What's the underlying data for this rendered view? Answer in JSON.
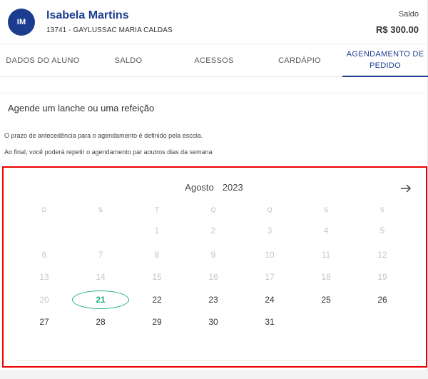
{
  "student": {
    "initials": "IM",
    "name": "Isabela Martins",
    "code_school": "13741 - GAYLUSSAC MARIA CALDAS",
    "balance_label": "Saldo",
    "balance_value": "R$ 300.00"
  },
  "tabs": [
    {
      "label": "DADOS DO ALUNO",
      "active": false
    },
    {
      "label": "SALDO",
      "active": false
    },
    {
      "label": "ACESSOS",
      "active": false
    },
    {
      "label": "CARDÁPIO",
      "active": false
    },
    {
      "label": "AGENDAMENTO DE PEDIDO",
      "active": true
    }
  ],
  "section_title": "Agende um lanche ou uma refeição",
  "info_lines": [
    "O prazo de antecedência para o agendamento é definido pela escola.",
    "Ao final, você poderá repetir o agendamento par aoutros dias da semana"
  ],
  "calendar": {
    "month": "Agosto",
    "year": "2023",
    "next_icon": "arrow-right-icon",
    "weekdays": [
      "D",
      "S",
      "T",
      "Q",
      "Q",
      "S",
      "S"
    ],
    "first_day_column": 2,
    "days_in_month": 31,
    "disabled_through": 20,
    "selected_day": 21,
    "selected_color": "#22b07d"
  }
}
